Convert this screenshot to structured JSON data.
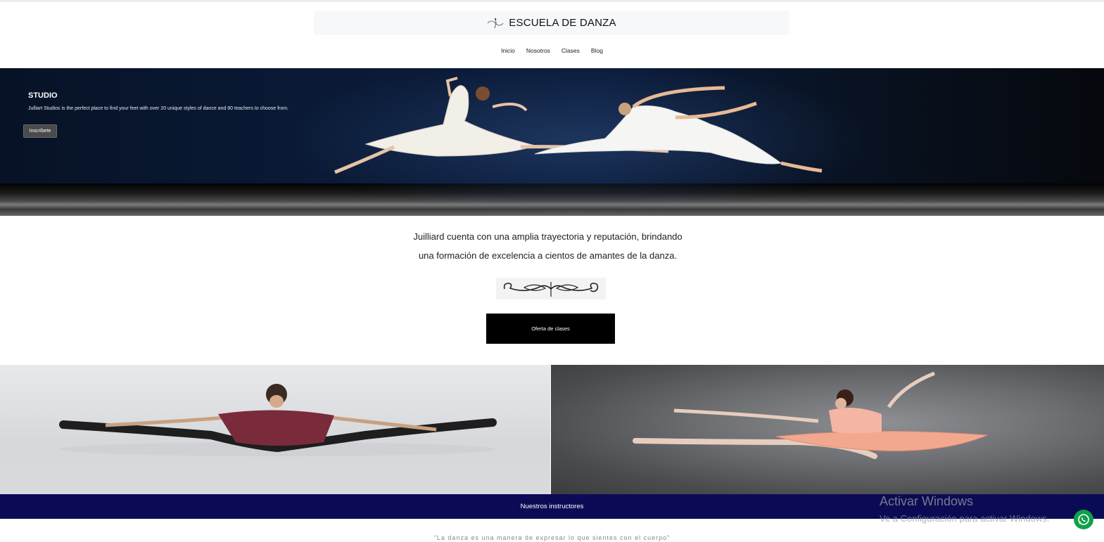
{
  "header": {
    "brand_title": "ESCUELA DE DANZA",
    "logo_icon": "dancer-logo-icon"
  },
  "nav": {
    "items": [
      {
        "label": "Inicio"
      },
      {
        "label": "Nosotros"
      },
      {
        "label": "Clases"
      },
      {
        "label": "Blog"
      }
    ]
  },
  "hero": {
    "title": "STUDIO",
    "text": "Julliart Studios is the perfect place to find your feet with over 20 unique styles of dance and 80 teachers to choose from.",
    "button_label": "Inscríbete"
  },
  "intro": {
    "line1": "Juilliard cuenta con una amplia trayectoria y reputación, brindando",
    "line2": "una formación de excelencia a cientos de amantes de la danza.",
    "ornament_icon": "flourish-ornament-icon",
    "cta_label": "Oferta de clases"
  },
  "photos": {
    "left_icon": "male-dancer-split-leap-image",
    "right_icon": "ballerina-leap-image"
  },
  "instructors": {
    "label": "Nuestros instructores",
    "quote": "\"La danza es una manera de expresar lo que sientes con el cuerpo\""
  },
  "watermark": {
    "title": "Activar Windows",
    "subtitle": "Ve a Configuración para activar Windows."
  },
  "colors": {
    "band": "#0b0b55",
    "cta": "#000000",
    "whatsapp": "#0fa14a"
  },
  "whatsapp_icon": "whatsapp-icon"
}
